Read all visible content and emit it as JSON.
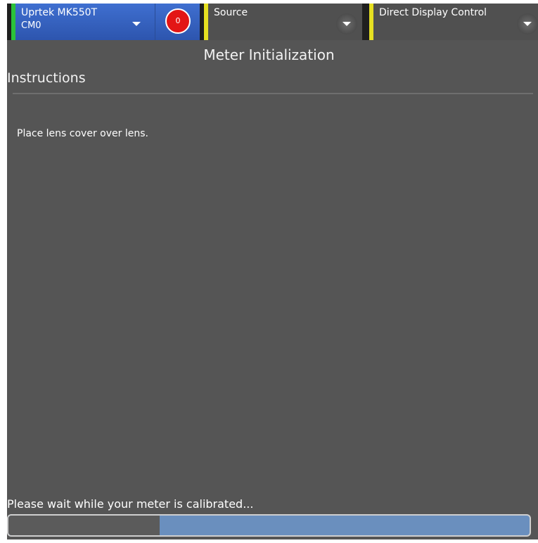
{
  "topbar": {
    "meter": {
      "name": "Uprtek MK550T",
      "port": "CM0",
      "stripe_color": "#2bc23a"
    },
    "badge": {
      "count": "0",
      "color": "#e31515"
    },
    "source": {
      "label": "Source",
      "stripe_color": "#e6e021"
    },
    "display_control": {
      "label": "Direct Display Control",
      "stripe_color": "#e6e021"
    }
  },
  "main": {
    "title": "Meter Initialization",
    "section_heading": "Instructions",
    "instruction_text": "Place lens cover over lens.",
    "status_text": "Please wait while your meter is calibrated...",
    "progress_fraction": 0.29
  },
  "icons": {
    "meter_dropdown": "chevron-down-icon",
    "source_dropdown": "chevron-down-icon",
    "display_control_dropdown": "chevron-down-icon"
  }
}
